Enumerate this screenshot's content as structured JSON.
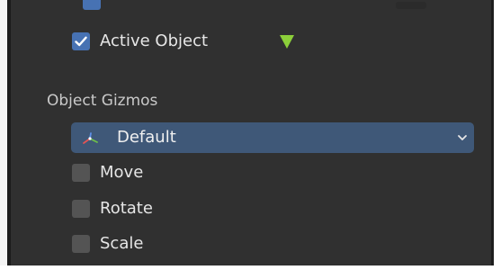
{
  "overlay": {
    "active_object": {
      "label": "Active Object",
      "checked": true,
      "marker_icon": "triangle-down-icon",
      "marker_color": "#8ccf3a"
    }
  },
  "object_gizmos": {
    "heading": "Object Gizmos",
    "orientation": {
      "selected": "Default",
      "icon": "gizmo-axes-icon"
    },
    "items": [
      {
        "label": "Move",
        "checked": false
      },
      {
        "label": "Rotate",
        "checked": false
      },
      {
        "label": "Scale",
        "checked": false
      }
    ]
  },
  "colors": {
    "panel_background": "#303030",
    "checkbox_on": "#4772b3",
    "checkbox_off": "#545454",
    "dropdown_background": "#3f5878",
    "text": "#e6e6e6"
  }
}
